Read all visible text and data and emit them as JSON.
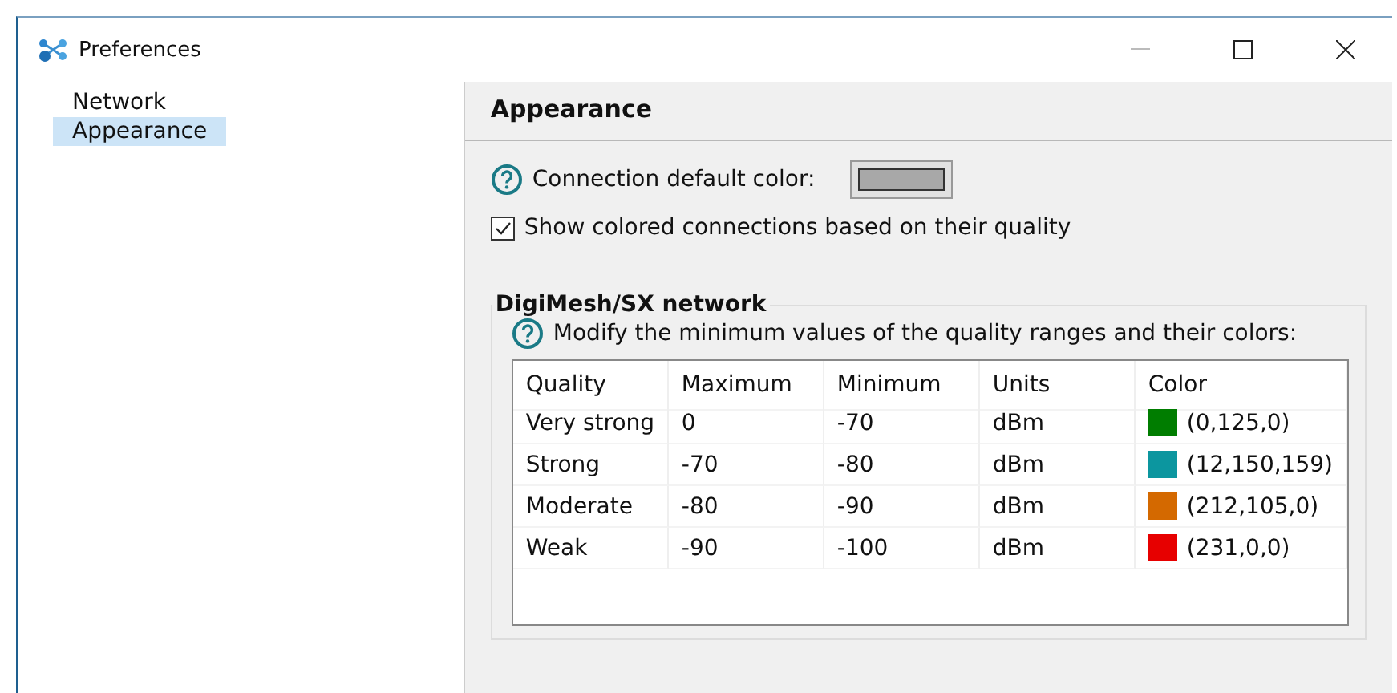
{
  "window": {
    "title": "Preferences"
  },
  "sidebar": {
    "items": [
      {
        "label": "Network",
        "selected": false
      },
      {
        "label": "Appearance",
        "selected": true
      }
    ]
  },
  "page": {
    "title": "Appearance",
    "default_color": {
      "label": "Connection default color:",
      "color": "#a8a8a8"
    },
    "show_colored": {
      "label": "Show colored connections based on their quality",
      "checked": true
    },
    "group": {
      "title": "DigiMesh/SX network",
      "hint": "Modify the minimum values of the quality ranges and their colors:",
      "table": {
        "columns": [
          "Quality",
          "Maximum",
          "Minimum",
          "Units",
          "Color"
        ],
        "rows": [
          {
            "quality": "Very strong",
            "maximum": "0",
            "minimum": "-70",
            "units": "dBm",
            "color": "#007d00",
            "color_text": "(0,125,0)"
          },
          {
            "quality": "Strong",
            "maximum": "-70",
            "minimum": "-80",
            "units": "dBm",
            "color": "#0c969f",
            "color_text": "(12,150,159)"
          },
          {
            "quality": "Moderate",
            "maximum": "-80",
            "minimum": "-90",
            "units": "dBm",
            "color": "#d46900",
            "color_text": "(212,105,0)"
          },
          {
            "quality": "Weak",
            "maximum": "-90",
            "minimum": "-100",
            "units": "dBm",
            "color": "#e70000",
            "color_text": "(231,0,0)"
          }
        ]
      }
    }
  }
}
